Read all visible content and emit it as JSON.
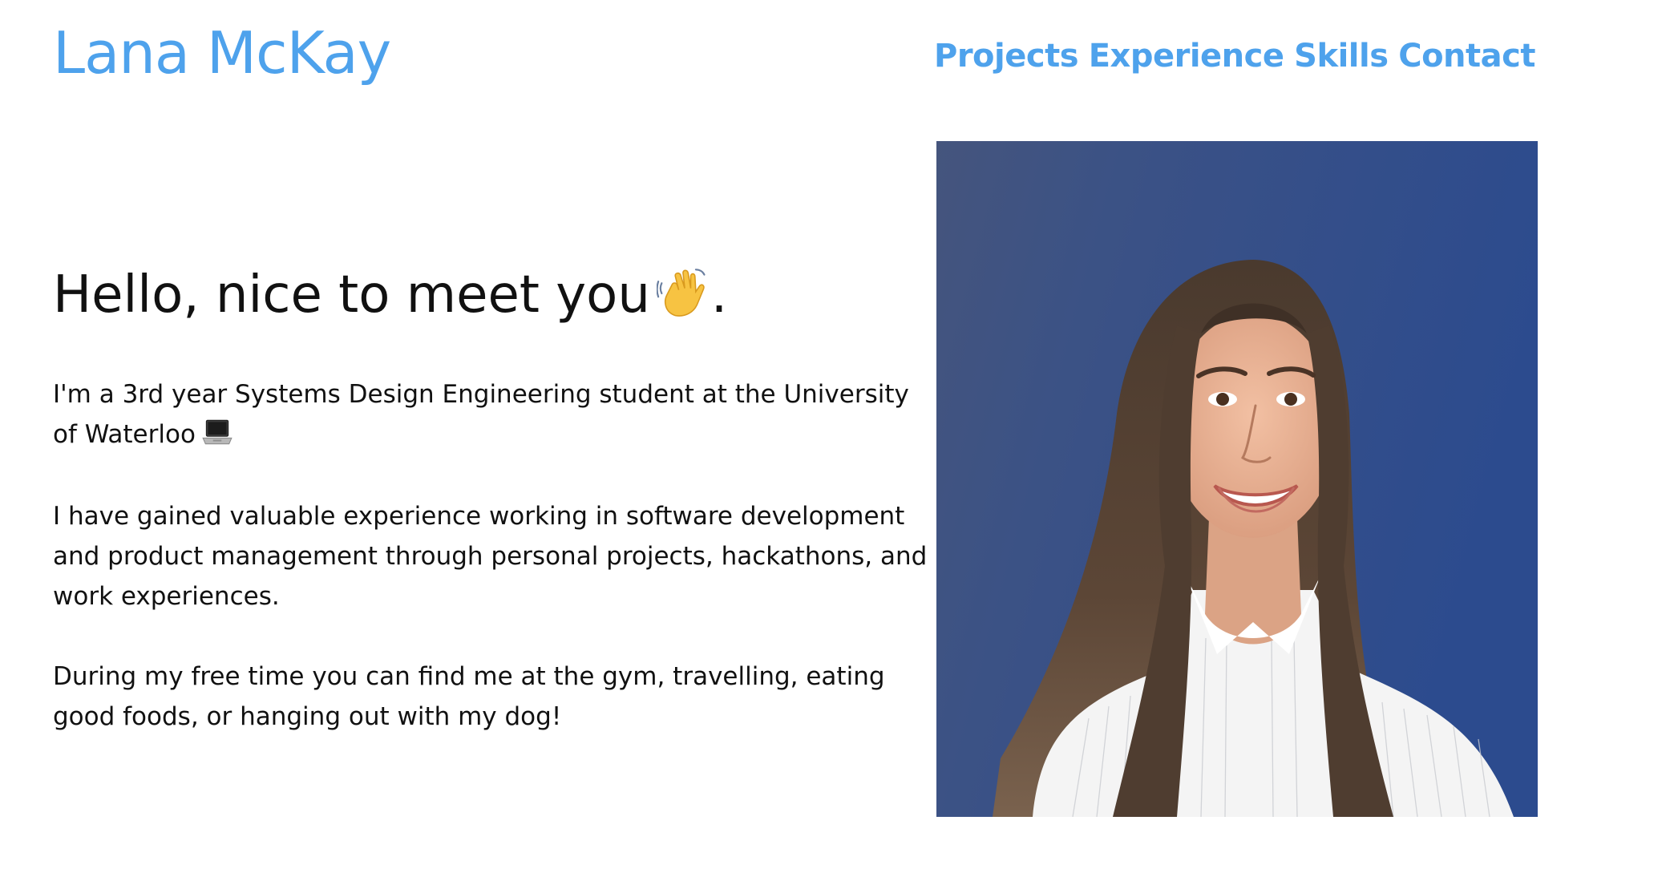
{
  "header": {
    "site_title": "Lana McKay",
    "nav": [
      {
        "label": "Projects"
      },
      {
        "label": "Experience"
      },
      {
        "label": "Skills"
      },
      {
        "label": "Contact"
      }
    ]
  },
  "intro": {
    "greeting": "Hello, nice to meet you",
    "greeting_suffix": ".",
    "paragraphs": [
      "I'm a 3rd year Systems Design Engineering student at the University of Waterloo",
      "I have gained valuable experience working in software development and product management through personal projects, hackathons, and work experiences.",
      "During my free time you can find me at the gym, travelling, eating good foods, or hanging out with my dog!"
    ]
  },
  "icons": {
    "greeting_emoji": "waving-hand-icon",
    "education_emoji": "laptop-icon"
  },
  "colors": {
    "accent": "#4ea2ec",
    "text": "#111111",
    "photo_background": "#2a4888"
  }
}
